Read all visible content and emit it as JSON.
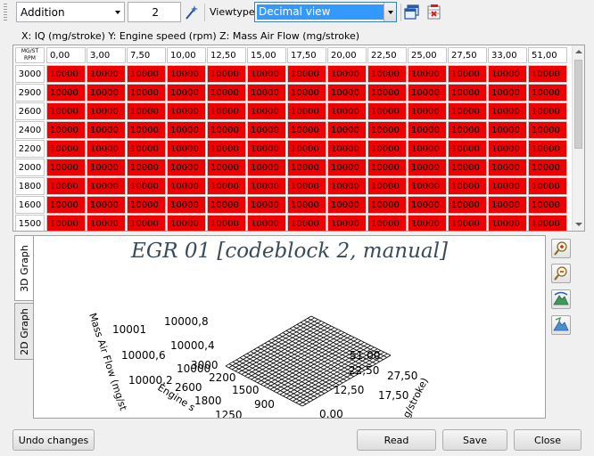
{
  "toolbar": {
    "operation": "Addition",
    "value": "2",
    "viewtype_label": "Viewtype",
    "viewtype_value": "Decimal view"
  },
  "axis_description": "X: IQ (mg/stroke) Y: Engine speed (rpm) Z: Mass Air Flow (mg/stroke)",
  "table": {
    "corner_top": "MG/ST",
    "corner_bottom": "RPM",
    "columns": [
      "0,00",
      "3,00",
      "7,50",
      "10,00",
      "12,50",
      "15,00",
      "17,50",
      "20,00",
      "22,50",
      "25,00",
      "27,50",
      "33,00",
      "51,00"
    ],
    "rows": [
      {
        "label": "3000",
        "cells": [
          "10000",
          "10000",
          "10000",
          "10000",
          "10000",
          "10000",
          "10000",
          "10000",
          "10000",
          "10000",
          "10000",
          "10000",
          "10000"
        ]
      },
      {
        "label": "2900",
        "cells": [
          "10000",
          "10000",
          "10000",
          "10000",
          "10000",
          "10000",
          "10000",
          "10000",
          "10000",
          "10000",
          "10000",
          "10000",
          "10000"
        ]
      },
      {
        "label": "2600",
        "cells": [
          "10000",
          "10000",
          "10000",
          "10000",
          "10000",
          "10000",
          "10000",
          "10000",
          "10000",
          "10000",
          "10000",
          "10000",
          "10000"
        ]
      },
      {
        "label": "2400",
        "cells": [
          "10000",
          "10000",
          "10000",
          "10000",
          "10000",
          "10000",
          "10000",
          "10000",
          "10000",
          "10000",
          "10000",
          "10000",
          "10000"
        ]
      },
      {
        "label": "2200",
        "cells": [
          "10000",
          "10000",
          "10000",
          "10000",
          "10000",
          "10000",
          "10000",
          "10000",
          "10000",
          "10000",
          "10000",
          "10000",
          "10000"
        ]
      },
      {
        "label": "2000",
        "cells": [
          "10000",
          "10000",
          "10000",
          "10000",
          "10000",
          "10000",
          "10000",
          "10000",
          "10000",
          "10000",
          "10000",
          "10000",
          "10000"
        ]
      },
      {
        "label": "1800",
        "cells": [
          "10000",
          "10000",
          "10000",
          "10000",
          "10000",
          "10000",
          "10000",
          "10000",
          "10000",
          "10000",
          "10000",
          "10000",
          "10000"
        ]
      },
      {
        "label": "1600",
        "cells": [
          "10000",
          "10000",
          "10000",
          "10000",
          "10000",
          "10000",
          "10000",
          "10000",
          "10000",
          "10000",
          "10000",
          "10000",
          "10000"
        ]
      },
      {
        "label": "1500",
        "cells": [
          "10000",
          "10000",
          "10000",
          "10000",
          "10000",
          "10000",
          "10000",
          "10000",
          "10000",
          "10000",
          "10000",
          "10000",
          "10000"
        ]
      }
    ],
    "cell_color": "#f00000"
  },
  "tabs": {
    "tab_3d": "3D Graph",
    "tab_2d": "2D Graph"
  },
  "graph": {
    "title": "EGR 01 [codeblock 2, manual]",
    "z_axis_label": "Mass Air Flow (mg/st",
    "y_axis_label": "Engine s",
    "x_axis_label": "g/stroke)",
    "z_ticks": [
      "10000,8",
      "10001",
      "10000,4",
      "10000,6",
      "10000",
      "10000,2"
    ],
    "y_ticks": [
      "3000",
      "2200",
      "2600",
      "1500",
      "1800",
      "900",
      "1250"
    ],
    "x_ticks": [
      "51,00",
      "22,50",
      "27,50",
      "12,50",
      "17,50",
      "0,00"
    ]
  },
  "buttons": {
    "undo": "Undo changes",
    "read": "Read",
    "save": "Save",
    "close": "Close"
  }
}
